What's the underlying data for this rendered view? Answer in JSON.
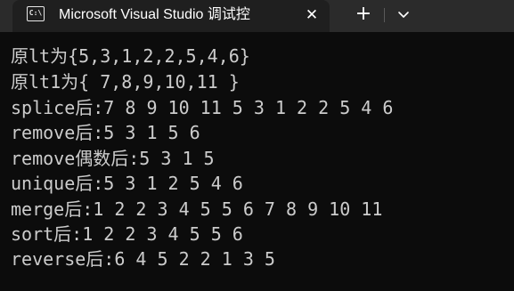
{
  "window": {
    "tab_icon_text": "C:\\",
    "tab_title": "Microsoft Visual Studio 调试控",
    "tab_close_glyph": "✕",
    "new_tab_glyph": "+",
    "dropdown_icon": "chevron-down-icon"
  },
  "console": {
    "lines": [
      "原lt为{5,3,1,2,2,5,4,6}",
      "原lt1为{ 7,8,9,10,11 }",
      "splice后:7 8 9 10 11 5 3 1 2 2 5 4 6",
      "remove后:5 3 1 5 6",
      "remove偶数后:5 3 1 5",
      "unique后:5 3 1 2 5 4 6",
      "merge后:1 2 2 3 4 5 5 6 7 8 9 10 11",
      "sort后:1 2 2 3 4 5 5 6",
      "reverse后:6 4 5 2 2 1 3 5"
    ]
  }
}
